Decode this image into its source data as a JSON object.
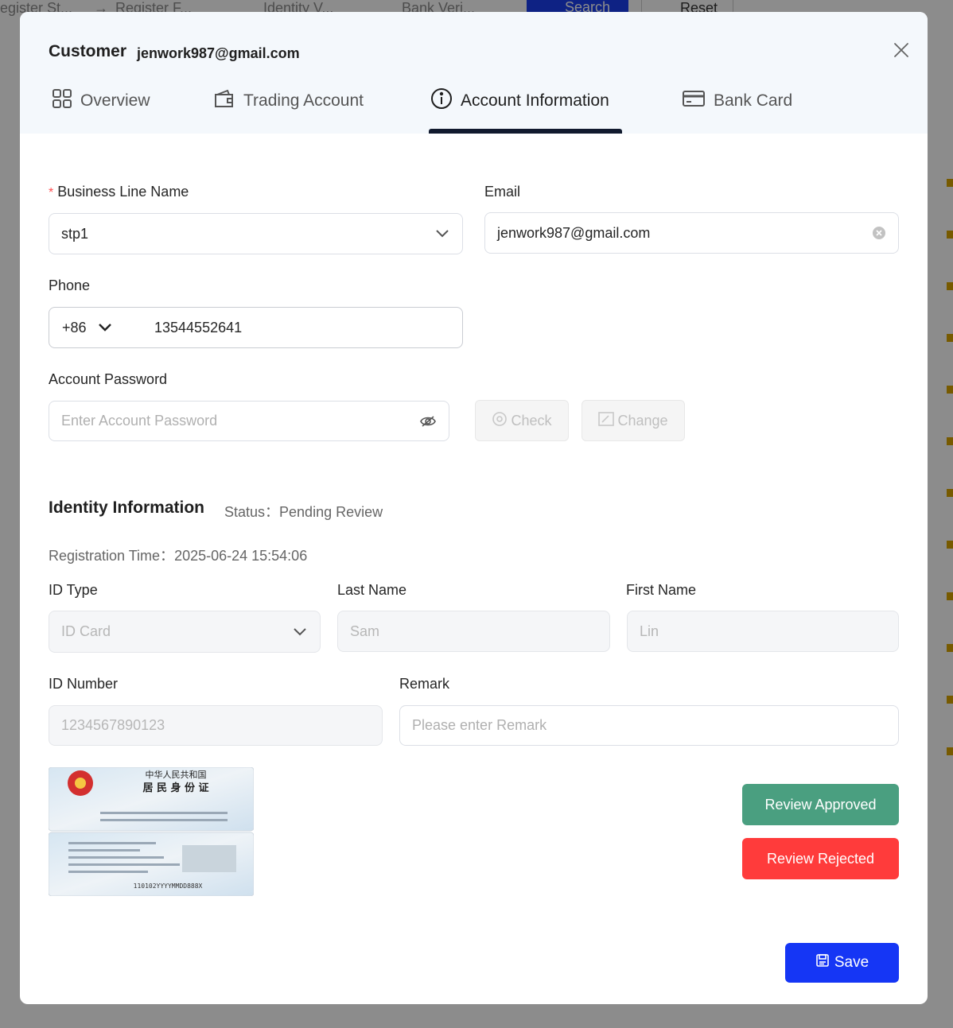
{
  "background": {
    "filters": [
      "egister St...",
      "Register F...",
      "Identity V...",
      "Bank Veri..."
    ],
    "search_label": "Search",
    "reset_label": "Reset"
  },
  "modal": {
    "customer_label": "Customer",
    "customer_email": "jenwork987@gmail.com",
    "tabs": [
      {
        "label": "Overview",
        "icon": "grid-icon",
        "active": false
      },
      {
        "label": "Trading Account",
        "icon": "wallet-icon",
        "active": false
      },
      {
        "label": "Account Information",
        "icon": "info-icon",
        "active": true
      },
      {
        "label": "Bank Card",
        "icon": "credit-card-icon",
        "active": false
      }
    ]
  },
  "form": {
    "business_line": {
      "label": "Business Line Name",
      "required": true,
      "value": "stp1"
    },
    "email": {
      "label": "Email",
      "value": "jenwork987@gmail.com"
    },
    "phone": {
      "label": "Phone",
      "country_code": "+86",
      "value": "13544552641"
    },
    "password": {
      "label": "Account Password",
      "placeholder": "Enter Account Password",
      "check_label": "Check",
      "change_label": "Change"
    }
  },
  "identity": {
    "title": "Identity Information",
    "status_label": "Status：",
    "status_value": "Pending Review",
    "registration_label": "Registration Time：",
    "registration_value": "2025-06-24 15:54:06",
    "id_type": {
      "label": "ID Type",
      "value": "ID Card"
    },
    "last_name": {
      "label": "Last Name",
      "value": "Sam"
    },
    "first_name": {
      "label": "First Name",
      "value": "Lin"
    },
    "id_number": {
      "label": "ID Number",
      "value": "1234567890123"
    },
    "remark": {
      "label": "Remark",
      "placeholder": "Please enter Remark"
    },
    "id_card_image": {
      "front_title": "中华人民共和国",
      "front_subtitle": "居 民 身 份 证",
      "back_number": "110102YYYYMMDD888X"
    }
  },
  "actions": {
    "approve_label": "Review Approved",
    "reject_label": "Review Rejected",
    "save_label": "Save"
  },
  "colors": {
    "primary": "#1536f5",
    "approve": "#4a9f80",
    "reject": "#ff3b3b",
    "tab_ink": "#111a2e"
  }
}
